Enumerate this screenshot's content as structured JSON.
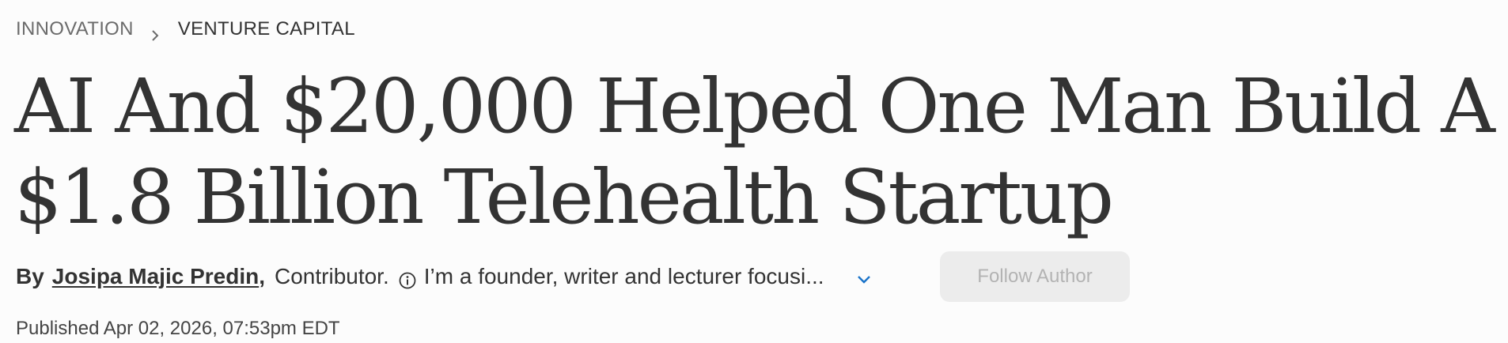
{
  "breadcrumb": {
    "level1": "INNOVATION",
    "level2": "VENTURE CAPITAL",
    "separator_icon": "chevron-right-icon"
  },
  "headline": "AI And $20,000 Helped One Man Build A $1.8 Billion Telehealth Startup",
  "byline": {
    "by_label": "By",
    "author_name": "Josipa Majic Predin",
    "comma": ",",
    "role": "Contributor.",
    "info_icon": "info-icon",
    "bio_snippet": "I’m a founder, writer and lecturer focusi...",
    "expand_icon": "chevron-down-icon",
    "expand_color": "#1a73c9"
  },
  "follow_button": {
    "label": "Follow Author"
  },
  "published": {
    "text": "Published Apr 02, 2026, 07:53pm EDT"
  },
  "colors": {
    "text": "#333333",
    "background": "#fcfcfc",
    "button_bg": "#ececec",
    "button_text": "#b3b3b3",
    "accent": "#1a73c9"
  }
}
